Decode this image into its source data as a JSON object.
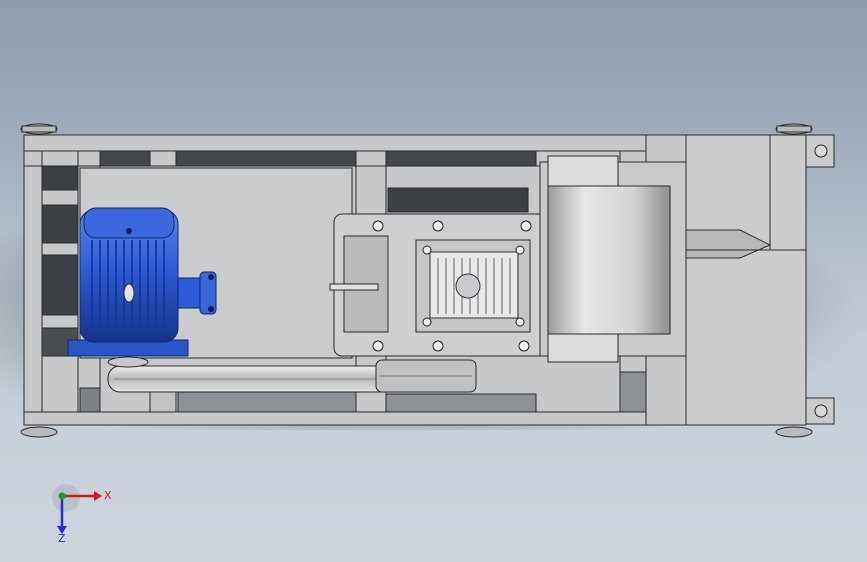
{
  "triad": {
    "x_label": "X",
    "z_label": "Z"
  },
  "colors": {
    "frame": "#c6c8ca",
    "frame_edge": "#2a2a2a",
    "motor_blue": "#2b5bd6",
    "motor_blue_dark": "#1a3c9a",
    "axis_x": "#d01818",
    "axis_z": "#1c2fd0",
    "axis_y": "#18a018"
  },
  "icons": [
    "coordinate-triad-icon"
  ]
}
